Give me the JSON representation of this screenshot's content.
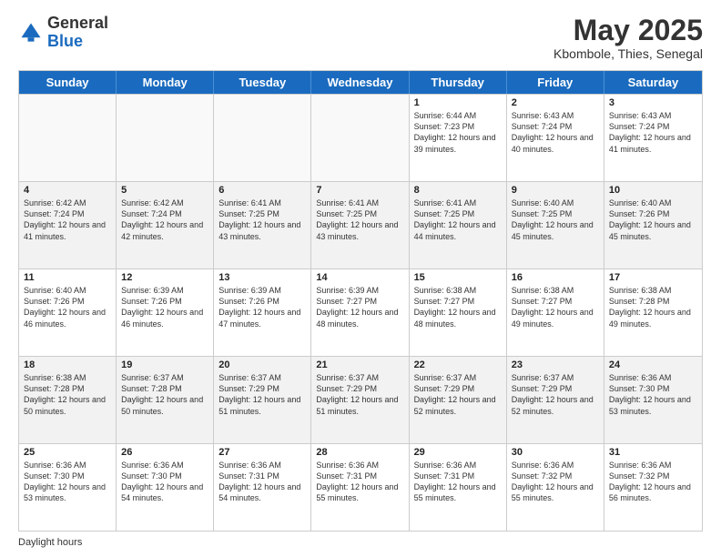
{
  "logo": {
    "general": "General",
    "blue": "Blue"
  },
  "header": {
    "month": "May 2025",
    "location": "Kbombole, Thies, Senegal"
  },
  "weekdays": [
    "Sunday",
    "Monday",
    "Tuesday",
    "Wednesday",
    "Thursday",
    "Friday",
    "Saturday"
  ],
  "footer": {
    "daylight_label": "Daylight hours"
  },
  "weeks": [
    [
      {
        "day": "",
        "sunrise": "",
        "sunset": "",
        "daylight": "",
        "empty": true
      },
      {
        "day": "",
        "sunrise": "",
        "sunset": "",
        "daylight": "",
        "empty": true
      },
      {
        "day": "",
        "sunrise": "",
        "sunset": "",
        "daylight": "",
        "empty": true
      },
      {
        "day": "",
        "sunrise": "",
        "sunset": "",
        "daylight": "",
        "empty": true
      },
      {
        "day": "1",
        "sunrise": "Sunrise: 6:44 AM",
        "sunset": "Sunset: 7:23 PM",
        "daylight": "Daylight: 12 hours and 39 minutes."
      },
      {
        "day": "2",
        "sunrise": "Sunrise: 6:43 AM",
        "sunset": "Sunset: 7:24 PM",
        "daylight": "Daylight: 12 hours and 40 minutes."
      },
      {
        "day": "3",
        "sunrise": "Sunrise: 6:43 AM",
        "sunset": "Sunset: 7:24 PM",
        "daylight": "Daylight: 12 hours and 41 minutes."
      }
    ],
    [
      {
        "day": "4",
        "sunrise": "Sunrise: 6:42 AM",
        "sunset": "Sunset: 7:24 PM",
        "daylight": "Daylight: 12 hours and 41 minutes."
      },
      {
        "day": "5",
        "sunrise": "Sunrise: 6:42 AM",
        "sunset": "Sunset: 7:24 PM",
        "daylight": "Daylight: 12 hours and 42 minutes."
      },
      {
        "day": "6",
        "sunrise": "Sunrise: 6:41 AM",
        "sunset": "Sunset: 7:25 PM",
        "daylight": "Daylight: 12 hours and 43 minutes."
      },
      {
        "day": "7",
        "sunrise": "Sunrise: 6:41 AM",
        "sunset": "Sunset: 7:25 PM",
        "daylight": "Daylight: 12 hours and 43 minutes."
      },
      {
        "day": "8",
        "sunrise": "Sunrise: 6:41 AM",
        "sunset": "Sunset: 7:25 PM",
        "daylight": "Daylight: 12 hours and 44 minutes."
      },
      {
        "day": "9",
        "sunrise": "Sunrise: 6:40 AM",
        "sunset": "Sunset: 7:25 PM",
        "daylight": "Daylight: 12 hours and 45 minutes."
      },
      {
        "day": "10",
        "sunrise": "Sunrise: 6:40 AM",
        "sunset": "Sunset: 7:26 PM",
        "daylight": "Daylight: 12 hours and 45 minutes."
      }
    ],
    [
      {
        "day": "11",
        "sunrise": "Sunrise: 6:40 AM",
        "sunset": "Sunset: 7:26 PM",
        "daylight": "Daylight: 12 hours and 46 minutes."
      },
      {
        "day": "12",
        "sunrise": "Sunrise: 6:39 AM",
        "sunset": "Sunset: 7:26 PM",
        "daylight": "Daylight: 12 hours and 46 minutes."
      },
      {
        "day": "13",
        "sunrise": "Sunrise: 6:39 AM",
        "sunset": "Sunset: 7:26 PM",
        "daylight": "Daylight: 12 hours and 47 minutes."
      },
      {
        "day": "14",
        "sunrise": "Sunrise: 6:39 AM",
        "sunset": "Sunset: 7:27 PM",
        "daylight": "Daylight: 12 hours and 48 minutes."
      },
      {
        "day": "15",
        "sunrise": "Sunrise: 6:38 AM",
        "sunset": "Sunset: 7:27 PM",
        "daylight": "Daylight: 12 hours and 48 minutes."
      },
      {
        "day": "16",
        "sunrise": "Sunrise: 6:38 AM",
        "sunset": "Sunset: 7:27 PM",
        "daylight": "Daylight: 12 hours and 49 minutes."
      },
      {
        "day": "17",
        "sunrise": "Sunrise: 6:38 AM",
        "sunset": "Sunset: 7:28 PM",
        "daylight": "Daylight: 12 hours and 49 minutes."
      }
    ],
    [
      {
        "day": "18",
        "sunrise": "Sunrise: 6:38 AM",
        "sunset": "Sunset: 7:28 PM",
        "daylight": "Daylight: 12 hours and 50 minutes."
      },
      {
        "day": "19",
        "sunrise": "Sunrise: 6:37 AM",
        "sunset": "Sunset: 7:28 PM",
        "daylight": "Daylight: 12 hours and 50 minutes."
      },
      {
        "day": "20",
        "sunrise": "Sunrise: 6:37 AM",
        "sunset": "Sunset: 7:29 PM",
        "daylight": "Daylight: 12 hours and 51 minutes."
      },
      {
        "day": "21",
        "sunrise": "Sunrise: 6:37 AM",
        "sunset": "Sunset: 7:29 PM",
        "daylight": "Daylight: 12 hours and 51 minutes."
      },
      {
        "day": "22",
        "sunrise": "Sunrise: 6:37 AM",
        "sunset": "Sunset: 7:29 PM",
        "daylight": "Daylight: 12 hours and 52 minutes."
      },
      {
        "day": "23",
        "sunrise": "Sunrise: 6:37 AM",
        "sunset": "Sunset: 7:29 PM",
        "daylight": "Daylight: 12 hours and 52 minutes."
      },
      {
        "day": "24",
        "sunrise": "Sunrise: 6:36 AM",
        "sunset": "Sunset: 7:30 PM",
        "daylight": "Daylight: 12 hours and 53 minutes."
      }
    ],
    [
      {
        "day": "25",
        "sunrise": "Sunrise: 6:36 AM",
        "sunset": "Sunset: 7:30 PM",
        "daylight": "Daylight: 12 hours and 53 minutes."
      },
      {
        "day": "26",
        "sunrise": "Sunrise: 6:36 AM",
        "sunset": "Sunset: 7:30 PM",
        "daylight": "Daylight: 12 hours and 54 minutes."
      },
      {
        "day": "27",
        "sunrise": "Sunrise: 6:36 AM",
        "sunset": "Sunset: 7:31 PM",
        "daylight": "Daylight: 12 hours and 54 minutes."
      },
      {
        "day": "28",
        "sunrise": "Sunrise: 6:36 AM",
        "sunset": "Sunset: 7:31 PM",
        "daylight": "Daylight: 12 hours and 55 minutes."
      },
      {
        "day": "29",
        "sunrise": "Sunrise: 6:36 AM",
        "sunset": "Sunset: 7:31 PM",
        "daylight": "Daylight: 12 hours and 55 minutes."
      },
      {
        "day": "30",
        "sunrise": "Sunrise: 6:36 AM",
        "sunset": "Sunset: 7:32 PM",
        "daylight": "Daylight: 12 hours and 55 minutes."
      },
      {
        "day": "31",
        "sunrise": "Sunrise: 6:36 AM",
        "sunset": "Sunset: 7:32 PM",
        "daylight": "Daylight: 12 hours and 56 minutes."
      }
    ]
  ]
}
